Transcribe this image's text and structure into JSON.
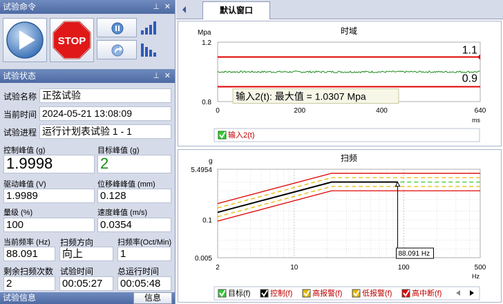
{
  "left_panel": {
    "command_title": "试验命令",
    "status_title": "试验状态",
    "info_title": "试验信息",
    "info_button": "信息",
    "stop_label": "STOP",
    "fields": {
      "test_name_label": "试验名称",
      "test_name": "正弦试验",
      "current_time_label": "当前时间",
      "current_time": "2024-05-21 13:08:09",
      "progress_label": "试验进程",
      "progress": "运行计划表试验 1 - 1",
      "control_peak_label": "控制峰值 (g)",
      "control_peak": "1.9998",
      "target_peak_label": "目标峰值 (g)",
      "target_peak": "2",
      "drive_peak_label": "驱动峰值 (V)",
      "drive_peak": "1.9989",
      "disp_peak_label": "位移峰峰值 (mm)",
      "disp_peak": "0.128",
      "level_label": "量级 (%)",
      "level": "100",
      "velocity_peak_label": "速度峰值 (m/s)",
      "velocity_peak": "0.0354",
      "cur_freq_label": "当前频率 (Hz)",
      "cur_freq": "88.091",
      "sweep_dir_label": "扫频方向",
      "sweep_dir": "向上",
      "sweep_rate_label": "扫频率(Oct/Min)",
      "sweep_rate": "1",
      "remaining_label": "剩余扫频次数",
      "remaining": "2",
      "test_time_label": "试验时间",
      "test_time": "00:05:27",
      "total_time_label": "总运行时间",
      "total_time": "00:05:48"
    }
  },
  "tabs": [
    {
      "label": "默认窗口"
    }
  ],
  "chart_data": [
    {
      "type": "line",
      "title": "时域",
      "ylabel": "Mpa",
      "xlabel": "ms",
      "xlim": [
        0,
        640
      ],
      "ylim": [
        0.8,
        1.2
      ],
      "x_ticks": [
        "0",
        "200",
        "400",
        "640"
      ],
      "y_ticks": [
        "1.2",
        "0.8"
      ],
      "upper_limit": 1.1,
      "lower_limit": 0.9,
      "upper_limit_label": "1.1",
      "lower_limit_label": "0.9",
      "signal_level": 1.0,
      "annotation": "输入2(t): 最大值 = 1.0307 Mpa",
      "legend": [
        {
          "name": "输入2(t)",
          "color": "#1a8a1a"
        }
      ],
      "colors": {
        "limit": "#e00000",
        "signal": "#1a8a1a"
      }
    },
    {
      "type": "line",
      "title": "扫频",
      "ylabel": "g",
      "xlabel": "Hz",
      "x_scale": "log",
      "y_scale": "log",
      "xlim": [
        2,
        500
      ],
      "ylim": [
        0.005,
        5.4954
      ],
      "x_ticks": [
        "2",
        "10",
        "100",
        "500"
      ],
      "y_ticks": [
        "5.4954",
        "0.1",
        "0.005"
      ],
      "cursor_label": "88.091 Hz",
      "cursor_x": 88.091,
      "knee_x": 22,
      "series": [
        {
          "name": "目标(f)",
          "color": "#33cc33",
          "plateau": 2
        },
        {
          "name": "控制(f)",
          "color": "#000000",
          "plateau": 1.9998
        },
        {
          "name": "高报警(f)",
          "color": "#e6b800",
          "plateau": 2.83
        },
        {
          "name": "低报警(f)",
          "color": "#e6b800",
          "plateau": 1.41
        },
        {
          "name": "高中断(f)",
          "color": "#e00000",
          "plateau": 4.0
        }
      ],
      "low_limit_red": 1.0
    }
  ]
}
